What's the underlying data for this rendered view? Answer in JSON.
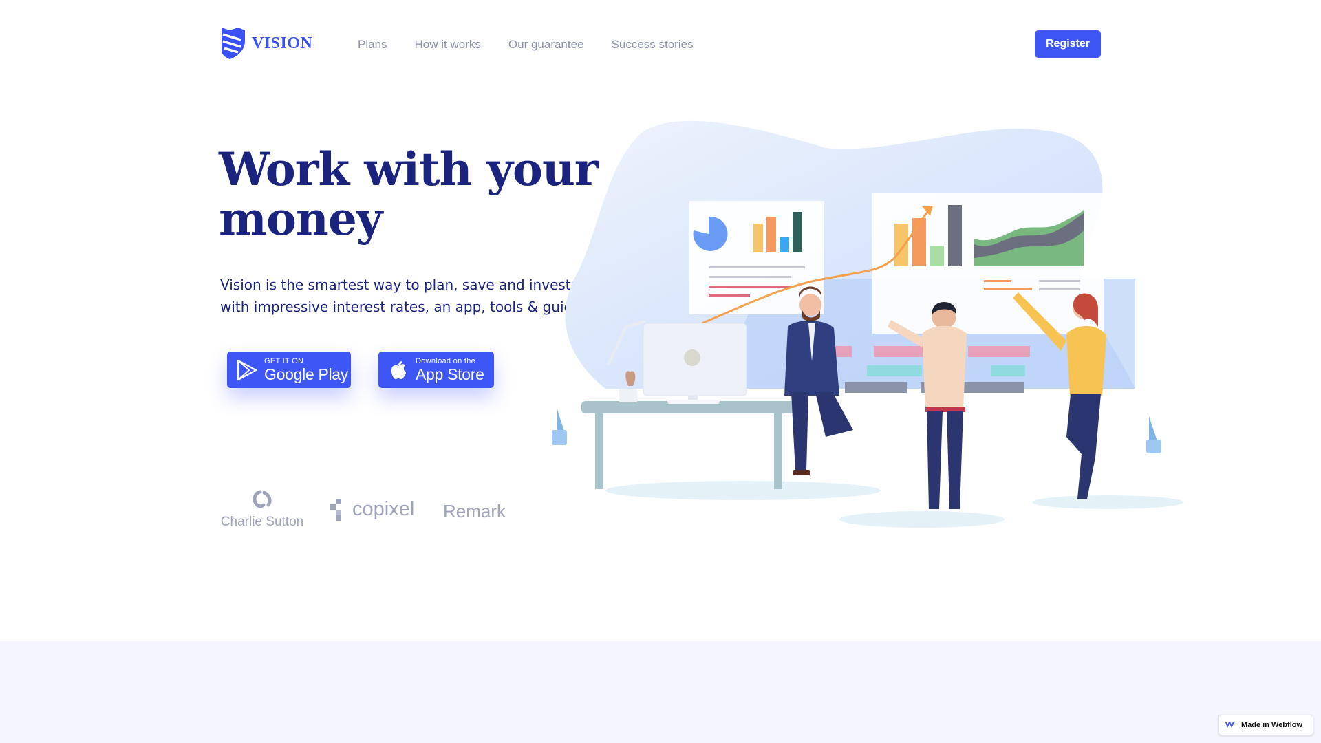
{
  "brand": {
    "name": "VISION",
    "logo_icon": "shield-logo-icon",
    "color": "#3a52f5"
  },
  "nav": {
    "items": [
      {
        "label": "Plans"
      },
      {
        "label": "How it works"
      },
      {
        "label": "Our guarantee"
      },
      {
        "label": "Success stories"
      }
    ],
    "register_label": "Register"
  },
  "hero": {
    "title": "Work with your money",
    "subtitle": "Vision is the smartest way to plan, save and investment with impressive interest rates, an app, tools & guides."
  },
  "stores": {
    "google": {
      "small": "GET IT ON",
      "big": "Google Play",
      "icon": "google-play-icon"
    },
    "apple": {
      "small": "Download on the",
      "big": "App Store",
      "icon": "apple-icon"
    }
  },
  "partners": [
    {
      "name": "Charlie Sutton",
      "icon": "charlie-sutton-logo-icon"
    },
    {
      "name": "copixel",
      "icon": "copixel-logo-icon"
    },
    {
      "name": "Remark"
    }
  ],
  "badge": {
    "label": "Made in Webflow",
    "icon": "webflow-icon"
  },
  "colors": {
    "accent": "#3d56f5",
    "heading": "#1a237e",
    "muted": "#8a91a8",
    "band": "#f5f6fd"
  }
}
